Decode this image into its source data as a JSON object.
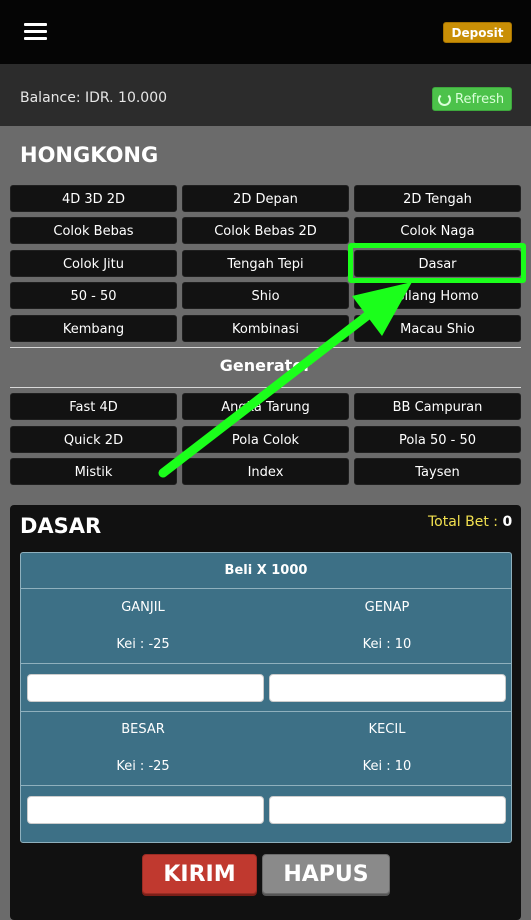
{
  "header": {
    "deposit_label": "Deposit"
  },
  "balance": {
    "text": "Balance: IDR. 10.000",
    "refresh_label": "Refresh"
  },
  "market": {
    "title": "HONGKONG"
  },
  "games": [
    "4D 3D 2D",
    "2D Depan",
    "2D Tengah",
    "Colok Bebas",
    "Colok Bebas 2D",
    "Colok Naga",
    "Colok Jitu",
    "Tengah Tepi",
    "Dasar",
    "50 - 50",
    "Shio",
    "Silang Homo",
    "Kembang",
    "Kombinasi",
    "Macau Shio"
  ],
  "generator": {
    "title": "Generator",
    "items": [
      "Fast 4D",
      "Angka Tarung",
      "BB Campuran",
      "Quick 2D",
      "Pola Colok",
      "Pola 50 - 50",
      "Mistik",
      "Index",
      "Taysen"
    ]
  },
  "bet_panel": {
    "title": "DASAR",
    "total_bet_label": "Total Bet : ",
    "total_bet_value": "0",
    "header": "Beli X 1000",
    "options": [
      {
        "label": "GANJIL",
        "kei": "Kei : -25"
      },
      {
        "label": "GENAP",
        "kei": "Kei : 10"
      },
      {
        "label": "BESAR",
        "kei": "Kei : -25"
      },
      {
        "label": "KECIL",
        "kei": "Kei : 10"
      }
    ],
    "submit_label": "KIRIM",
    "clear_label": "HAPUS"
  },
  "colors": {
    "highlight": "#1bff1b",
    "deposit": "#c98f06",
    "refresh": "#4cc24a",
    "submit": "#c0392f",
    "bet_box": "#3d7086"
  }
}
